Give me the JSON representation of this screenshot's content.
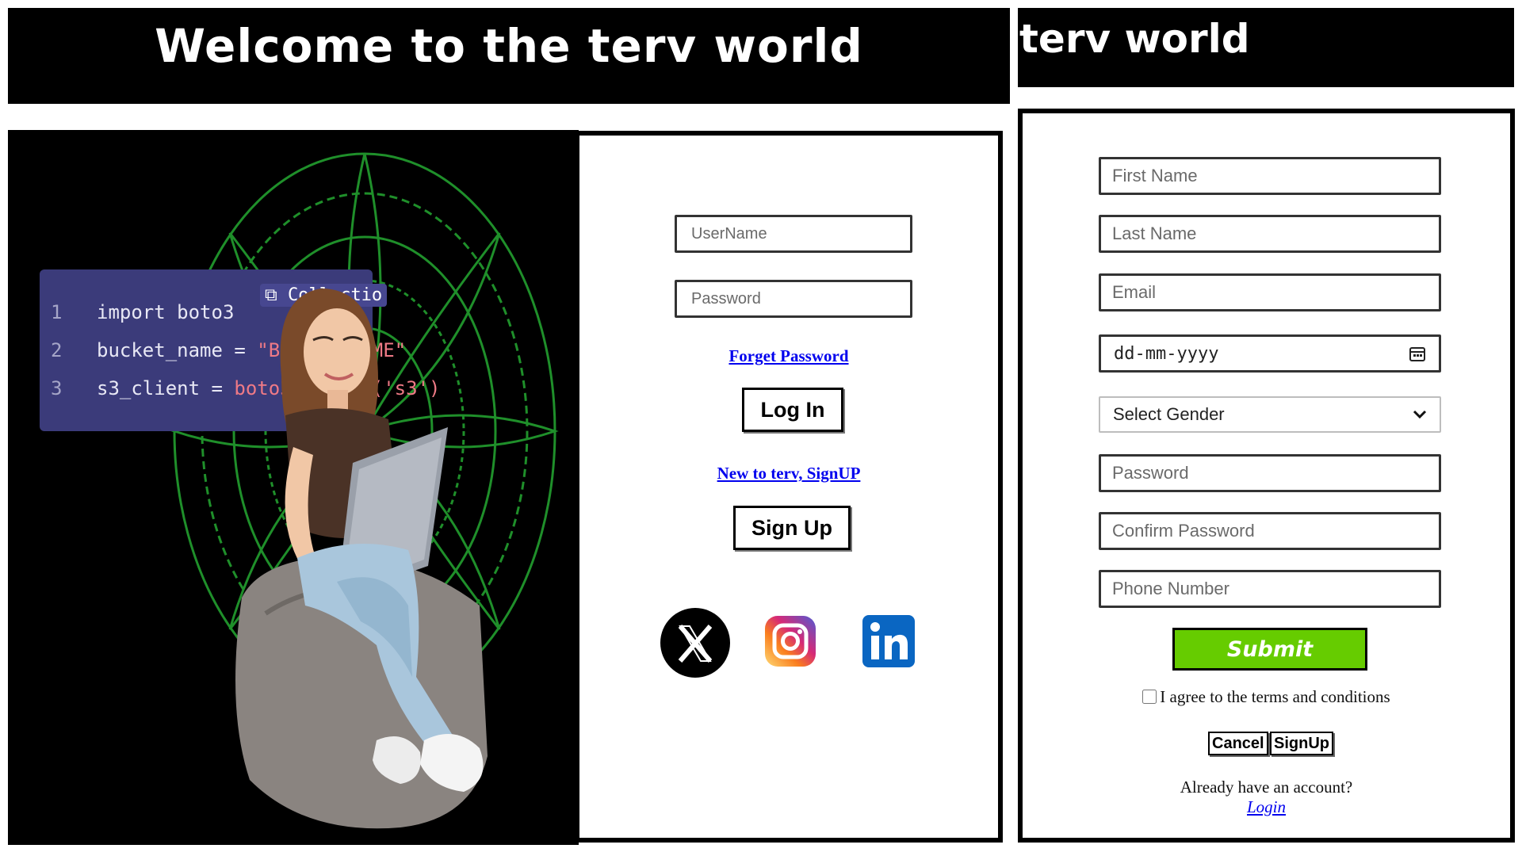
{
  "header": {
    "welcome_title": "Welcome to the terv world",
    "right_title": "terv world"
  },
  "hero": {
    "code": {
      "lines": [
        {
          "num": "1",
          "text": "import boto3",
          "str": ""
        },
        {
          "num": "2",
          "text": "bucket_name = ",
          "str": "\"BUCKET_NAME\""
        },
        {
          "num": "3",
          "text": "s3_client = ",
          "str": "boto3.client('s3')"
        }
      ],
      "collection_label": "Collectio"
    }
  },
  "login": {
    "username_placeholder": "UserName",
    "password_placeholder": "Password",
    "forget_password": "Forget Password",
    "login_button": "Log In",
    "signup_link": "New to terv, SignUP",
    "signup_button": "Sign Up",
    "social": [
      "x-icon",
      "instagram-icon",
      "linkedin-icon"
    ]
  },
  "signup": {
    "first_name_placeholder": "First Name",
    "last_name_placeholder": "Last Name",
    "email_placeholder": "Email",
    "dob_placeholder": "dd-mm-yyyy",
    "gender_selected": "Select Gender",
    "password_placeholder": "Password",
    "confirm_password_placeholder": "Confirm Password",
    "phone_placeholder": "Phone Number",
    "submit": "Submit",
    "terms": "I agree to the terms and conditions",
    "cancel": "Cancel",
    "signup": "SignUp",
    "already": "Already have an account?",
    "login": "Login"
  },
  "colors": {
    "banner_bg": "#000000",
    "submit_bg": "#66cc00",
    "link": "#0000ee",
    "code_card": "#3b3b7a"
  }
}
